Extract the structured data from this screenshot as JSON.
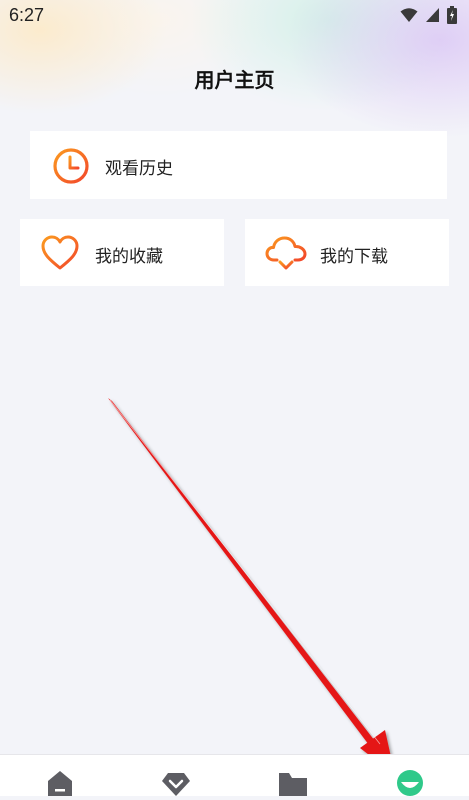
{
  "status_bar": {
    "time": "6:27",
    "icons": [
      "wifi-icon",
      "signal-icon",
      "battery-icon"
    ]
  },
  "page": {
    "title": "用户主页"
  },
  "cards": {
    "history": {
      "label": "观看历史",
      "icon": "clock-icon"
    },
    "favorites": {
      "label": "我的收藏",
      "icon": "heart-icon"
    },
    "downloads": {
      "label": "我的下载",
      "icon": "cloud-download-icon"
    }
  },
  "bottom_nav": {
    "items": [
      {
        "icon": "home-icon",
        "active": false
      },
      {
        "icon": "diamond-icon",
        "active": false
      },
      {
        "icon": "folder-icon",
        "active": false
      },
      {
        "icon": "profile-icon",
        "active": true
      }
    ]
  },
  "colors": {
    "accent_orange": "#f2662b",
    "accent_orange_light": "#fb9a1f",
    "nav_inactive": "#5d5d63",
    "nav_active": "#2fc98a",
    "annotation_arrow": "#e51616",
    "background": "#f3f4f9"
  }
}
